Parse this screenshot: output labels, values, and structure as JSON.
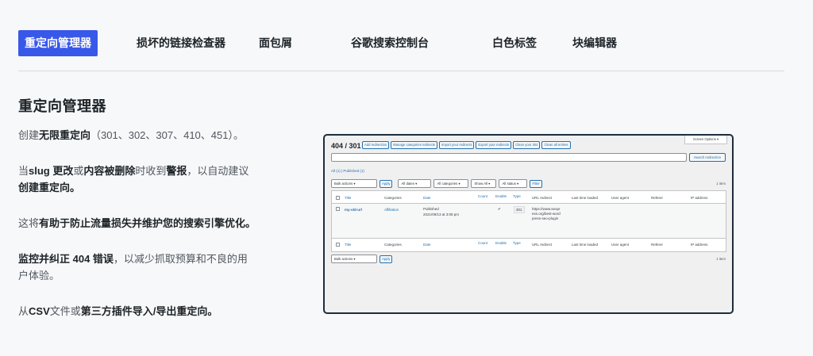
{
  "tabs": [
    {
      "label": "重定向管理器",
      "active": true
    },
    {
      "label": "损坏的链接检查器"
    },
    {
      "label": "面包屑"
    },
    {
      "label": "谷歌搜索控制台"
    },
    {
      "label": "白色标签"
    },
    {
      "label": "块编辑器"
    }
  ],
  "section": {
    "heading": "重定向管理器",
    "p1_a": "创建",
    "p1_b": "无限重定向",
    "p1_c": "（301、302、307、410、451）。",
    "p2_a": "当",
    "p2_b": "slug 更改",
    "p2_c": "或",
    "p2_d": "内容被删除",
    "p2_e": "时收到",
    "p2_f": "警报",
    "p2_g": "，以自动建议",
    "p2_h": "创建重定向。",
    "p3_a": "这将",
    "p3_b": "有助于防止流量损失并维护您的搜索引擎优化。",
    "p4_a": "监控并纠正 404 错误",
    "p4_b": "，以减少抓取预算和不良的用户体验。",
    "p5_a": "从",
    "p5_b": "CSV",
    "p5_c": "文件或",
    "p5_d": "第三方插件导入/导出重定向。"
  },
  "shot": {
    "title": "404 / 301",
    "buttons": [
      "Add redirection",
      "Manage categories redirects",
      "Import your redirects",
      "Export your redirects",
      "Clean your 404",
      "Clean all entries"
    ],
    "screen_options": "Screen Options ▾",
    "search_button": "Search redirection",
    "subsub": "All (1) | Published (1)",
    "bulk": "Bulk actions",
    "apply": "Apply",
    "all_dates": "All dates",
    "all_categories": "All categories",
    "show_all": "Show All",
    "all_status": "All status",
    "filter": "Filter",
    "item_count": "1 item",
    "columns": [
      "Title",
      "Categories",
      "Date",
      "Count",
      "Enable",
      "Type",
      "URL redirect",
      "Last time loaded",
      "User agent",
      "Referer",
      "IP address"
    ],
    "row": {
      "title": "my-old-url",
      "category": "Affiliation",
      "date_status": "Published",
      "date": "2021/09/13 at 3:08 pm",
      "enable": "✔",
      "type": "301",
      "url": "https://www.seopress.org/best-wordpress-seo-plugin"
    }
  }
}
